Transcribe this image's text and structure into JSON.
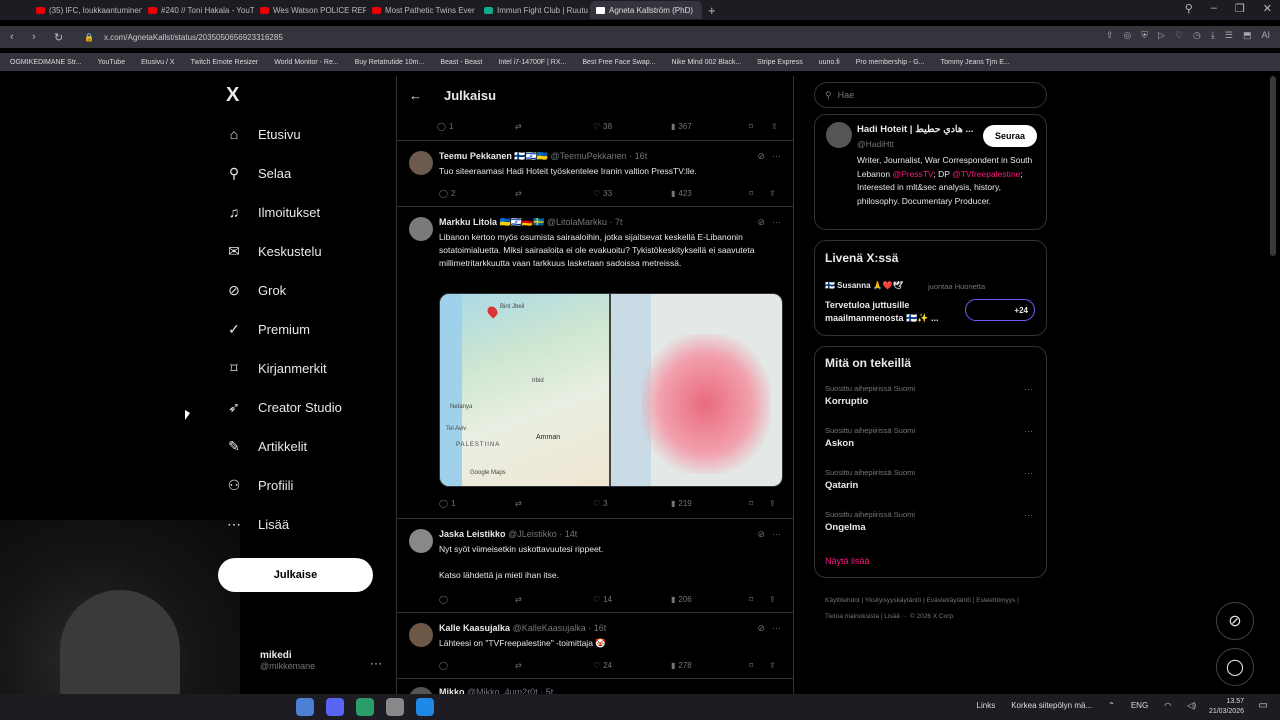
{
  "browser": {
    "tabs": [
      "(35) IFC, loukkaantuminen",
      "#240 // Toni Hakala - YouT",
      "Wes Watson POLICE REPO",
      "Most Pathetic Twins Ever",
      "Immun Fight Club | Ruutu",
      "Agneta Kallström (PhD)"
    ],
    "url": "x.com/AgnetaKallst/status/2035050656923316285",
    "bookmarks": [
      "OGMIKEDIMANE Str...",
      "YouTube",
      "Etusivu / X",
      "Twitch Emote Resizer",
      "World Monitor - Re...",
      "Buy Retatrutide 10m...",
      "Beast - Beast",
      "Intel i7-14700F | RX...",
      "Best Free Face Swap...",
      "Nike Mind 002 Black...",
      "Stripe Express",
      "uuno.fi",
      "Pro membership - G...",
      "Tommy Jeans Tjm E..."
    ]
  },
  "sidebar": {
    "logo": "X",
    "items": [
      {
        "label": "Etusivu",
        "icon": "home-icon",
        "glyph": "⌂"
      },
      {
        "label": "Selaa",
        "icon": "search-icon",
        "glyph": "⚲"
      },
      {
        "label": "Ilmoitukset",
        "icon": "bell-icon",
        "glyph": "♫"
      },
      {
        "label": "Keskustelu",
        "icon": "mail-icon",
        "glyph": "✉"
      },
      {
        "label": "Grok",
        "icon": "grok-icon",
        "glyph": "⊘"
      },
      {
        "label": "Premium",
        "icon": "verified-icon",
        "glyph": "✓"
      },
      {
        "label": "Kirjanmerkit",
        "icon": "bookmark-icon",
        "glyph": "⌑"
      },
      {
        "label": "Creator Studio",
        "icon": "rocket-icon",
        "glyph": "➶"
      },
      {
        "label": "Artikkelit",
        "icon": "article-icon",
        "glyph": "✎"
      },
      {
        "label": "Profiili",
        "icon": "profile-icon",
        "glyph": "⚇"
      },
      {
        "label": "Lisää",
        "icon": "more-icon",
        "glyph": "⋯"
      }
    ],
    "post_button": "Julkaise",
    "user": {
      "name": "mikedi",
      "handle": "@mikkemane"
    }
  },
  "main": {
    "header": "Julkaisu",
    "top_actions": {
      "replies": "1",
      "likes": "38",
      "views": "367"
    },
    "tweets": [
      {
        "name": "Teemu Pekkanen 🇫🇮🇮🇱🇺🇦",
        "handle": "@TeemuPekkanen · 16t",
        "text": "Tuo siteeraamasi Hadi Hoteit työskentelee Iranin valtion PressTV:lle.",
        "replies": "2",
        "retweets": "",
        "likes": "33",
        "views": "423"
      },
      {
        "name": "Markku Litola 🇺🇦🇮🇱🇩🇪🇸🇪",
        "handle": "@LitolaMarkku · 7t",
        "text": "Libanon kertoo myös osumista sairaaloihin, jotka sijaitsevat keskellä E-Libanonin sotatoimialuetta. Miksi sairaaloita ei ole evakuoitu? Tykistökeskityksellä ei saavuteta millimetritarkkuutta vaan tarkkuus lasketaan sadoissa metreissä.",
        "replies": "1",
        "retweets": "",
        "likes": "3",
        "views": "219"
      },
      {
        "name": "Jaska Leistikko",
        "handle": "@JLeistikko · 14t",
        "text": "Nyt syöt viimeisetkin uskottavuutesi rippeet.",
        "text2": "Katso lähdettä ja mieti ihan itse.",
        "replies": "",
        "retweets": "",
        "likes": "14",
        "views": "206"
      },
      {
        "name": "Kalle Kaasujalka",
        "handle": "@KalleKaasujalka · 16t",
        "text": "Lähteesi on \"TVFreepalestine\" -toimittaja 🤡",
        "replies": "",
        "retweets": "",
        "likes": "24",
        "views": "278"
      },
      {
        "name": "Mikko",
        "handle": "@Mikko_4um2r0t · 5t"
      }
    ],
    "map_labels": [
      "Bint Jbeil",
      "Irbid",
      "Netanya",
      "Tel Aviv",
      "Amman",
      "PALESTIINA",
      "Google Maps"
    ]
  },
  "right": {
    "search_placeholder": "Hae",
    "profile": {
      "name": "Hadi Hoteit | هادي حطيط ...",
      "handle": "@HadiHtt",
      "follow": "Seuraa",
      "bio1": "Writer, Journalist, War Correspondent in South Lebanon ",
      "bio_link1": "@PressTV",
      "bio2": "; DP ",
      "bio_link2": "@TVfreepalestine",
      "bio3": "; Interested in mlt&sec analysis, history, philosophy. Documentary Producer."
    },
    "live": {
      "title": "Livenä X:ssä",
      "host": "🇫🇮 Susanna 🙏❤️🕊",
      "joined": "juontaa Huonetta",
      "text": "Tervetuloa juttusille maailmanmenosta 🇫🇮✨ ...",
      "count": "+24"
    },
    "trends_title": "Mitä on tekeillä",
    "trends": [
      {
        "category": "Suosittu aihepiirissä Suomi",
        "topic": "Korruptio"
      },
      {
        "category": "Suosittu aihepiirissä Suomi",
        "topic": "Askon"
      },
      {
        "category": "Suosittu aihepiirissä Suomi",
        "topic": "Qatarin"
      },
      {
        "category": "Suosittu aihepiirissä Suomi",
        "topic": "Ongelma"
      }
    ],
    "show_more": "Näytä lisää",
    "footer": "Käyttöehdot | Yksityisyyskäytäntö | Evästekäytäntö | Esteettömyys | Tietoa mainoksista | Lisää ··· © 2026 X Corp."
  },
  "taskbar": {
    "links": "Links",
    "weather": "Korkea siitepölyn mä...",
    "lang": "ENG",
    "time": "13.57",
    "date": "21/03/2026"
  }
}
